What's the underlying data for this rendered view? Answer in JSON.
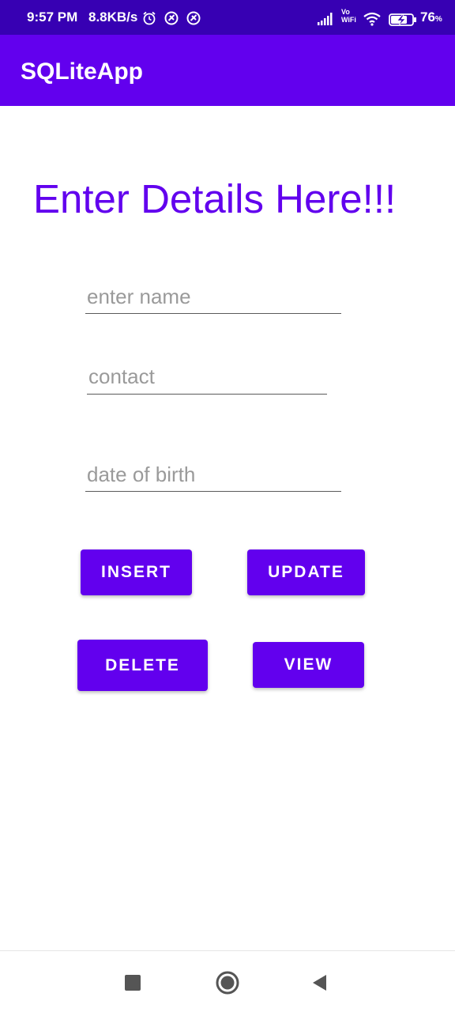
{
  "status_bar": {
    "time": "9:57 PM",
    "net_speed": "8.8KB/s",
    "vowifi_top": "Vo",
    "vowifi_bottom": "WiFi",
    "battery_level": "76",
    "battery_unit": "%",
    "icons": [
      "alarm-icon",
      "app-notification-icon",
      "app-notification-icon",
      "signal-icon",
      "wifi-icon",
      "battery-charging-icon"
    ]
  },
  "app_bar": {
    "title": "SQLiteApp"
  },
  "main": {
    "heading": "Enter Details Here!!!",
    "fields": {
      "name": {
        "placeholder": "enter name",
        "value": ""
      },
      "contact": {
        "placeholder": "contact",
        "value": ""
      },
      "dob": {
        "placeholder": "date of birth",
        "value": ""
      }
    },
    "buttons": {
      "insert": "INSERT",
      "update": "UPDATE",
      "delete": "DELETE",
      "view": "VIEW"
    }
  },
  "nav_bar": {
    "icons": [
      "recents-icon",
      "home-icon",
      "back-icon"
    ]
  },
  "colors": {
    "status_bar": "#3700b3",
    "primary": "#6200ee",
    "background": "#ffffff",
    "hint": "#9a9a9a"
  }
}
